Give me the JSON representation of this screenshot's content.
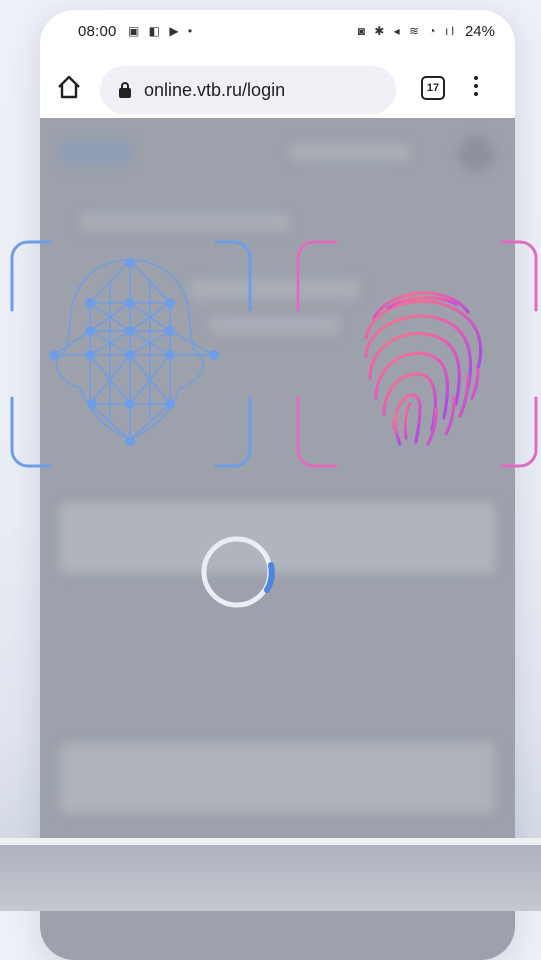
{
  "status_bar": {
    "time": "08:00",
    "battery": "24%"
  },
  "browser": {
    "url": "online.vtb.ru/login",
    "tab_count": "17"
  },
  "icons": {
    "home": "home-icon",
    "lock": "lock-icon",
    "menu": "more-vert-icon",
    "face": "face-id-icon",
    "fingerprint": "fingerprint-icon",
    "spinner": "loading-spinner"
  },
  "loading": {
    "progress": 0.12
  },
  "colors": {
    "face_frame": "#6e9de8",
    "fingerprint_frame": "#e26bc0",
    "spinner_track": "#e9eef6",
    "spinner_accent": "#4c86e0"
  }
}
